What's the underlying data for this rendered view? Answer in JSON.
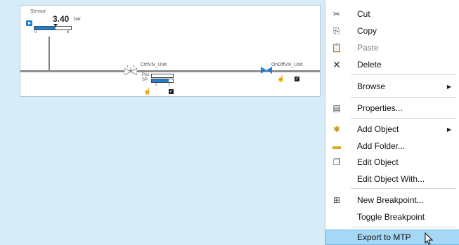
{
  "canvas": {
    "sensor": {
      "name": "Sensor",
      "value": "3.40",
      "unit": "bar",
      "scale_min": "0",
      "scale_max": "6",
      "fill_fraction": 0.57
    },
    "ctrl_valve": {
      "name": "CtrlVlv_Unit",
      "pos_label": "Pos",
      "sp_label": "SP",
      "scale_min": "0",
      "scale_max": "1",
      "pos_fraction": 0.0,
      "sp_fraction": 0.8
    },
    "onoff_valve": {
      "name": "OnOffVlv_Unit"
    }
  },
  "context_menu": {
    "cut": "Cut",
    "copy": "Copy",
    "paste": "Paste",
    "delete": "Delete",
    "browse": "Browse",
    "properties": "Properties...",
    "add_object": "Add Object",
    "add_folder": "Add Folder...",
    "edit_object": "Edit Object",
    "edit_object_with": "Edit Object With...",
    "new_breakpoint": "New Breakpoint...",
    "toggle_breakpoint": "Toggle Breakpoint",
    "export_mtp": "Export to MTP"
  },
  "colors": {
    "accent": "#1f7fd6",
    "highlight": "#a6d7f5",
    "background": "#d6ecf8"
  }
}
